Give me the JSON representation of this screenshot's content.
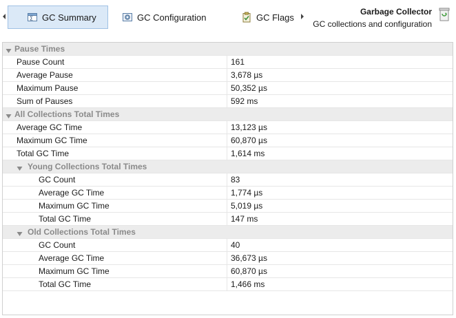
{
  "toolbar": {
    "tabs": [
      {
        "label": "GC Summary",
        "active": true,
        "icon": "sigma-table-icon"
      },
      {
        "label": "GC Configuration",
        "active": false,
        "icon": "gear-config-icon"
      },
      {
        "label": "GC Flags",
        "active": false,
        "icon": "clipboard-check-icon"
      }
    ],
    "title": "Garbage Collector",
    "subtitle": "GC collections and configuration"
  },
  "colors": {
    "active_tab_bg": "#dbe9f7",
    "active_tab_border": "#9fc1e4",
    "group_row_bg": "#ececec",
    "group_row_text": "#8a8a8a"
  },
  "table": {
    "groups": [
      {
        "label": "Pause Times",
        "rows": [
          {
            "label": "Pause Count",
            "value": "161"
          },
          {
            "label": "Average Pause",
            "value": "3,678 µs"
          },
          {
            "label": "Maximum Pause",
            "value": "50,352 µs"
          },
          {
            "label": "Sum of Pauses",
            "value": "592 ms"
          }
        ]
      },
      {
        "label": "All Collections Total Times",
        "rows": [
          {
            "label": "Average GC Time",
            "value": "13,123 µs"
          },
          {
            "label": "Maximum GC Time",
            "value": "60,870 µs"
          },
          {
            "label": "Total GC Time",
            "value": "1,614 ms"
          }
        ],
        "subgroups": [
          {
            "label": "Young Collections Total Times",
            "rows": [
              {
                "label": "GC Count",
                "value": "83"
              },
              {
                "label": "Average GC Time",
                "value": "1,774 µs"
              },
              {
                "label": "Maximum GC Time",
                "value": "5,019 µs"
              },
              {
                "label": "Total GC Time",
                "value": "147 ms"
              }
            ]
          },
          {
            "label": "Old Collections Total Times",
            "rows": [
              {
                "label": "GC Count",
                "value": "40"
              },
              {
                "label": "Average GC Time",
                "value": "36,673 µs"
              },
              {
                "label": "Maximum GC Time",
                "value": "60,870 µs"
              },
              {
                "label": "Total GC Time",
                "value": "1,466 ms"
              }
            ]
          }
        ]
      }
    ]
  }
}
